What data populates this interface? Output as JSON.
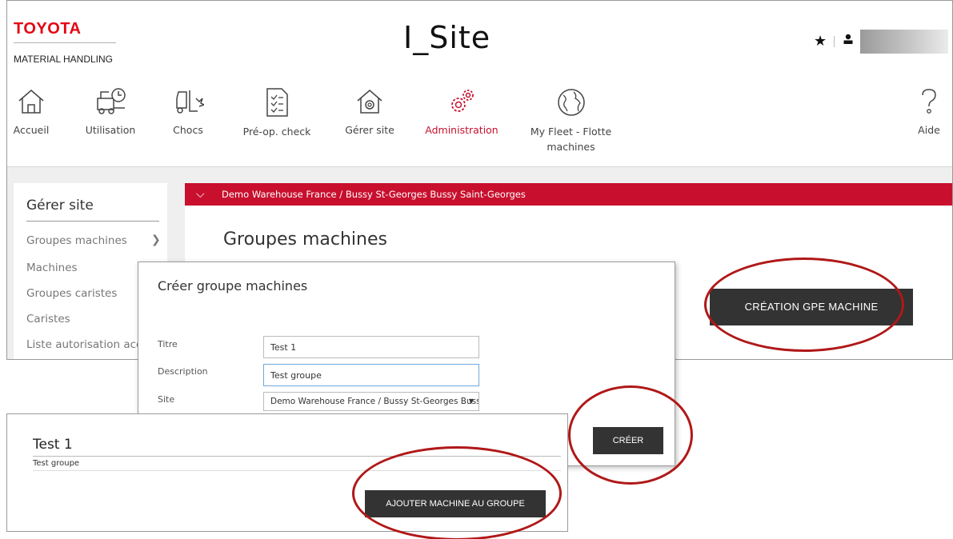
{
  "brand": {
    "name": "TOYOTA",
    "subtitle": "MATERIAL HANDLING"
  },
  "app_title": "I_Site",
  "header": {
    "star_icon": "★",
    "user_icon": "👤"
  },
  "nav": [
    {
      "label": "Accueil",
      "icon": "home-icon"
    },
    {
      "label": "Utilisation",
      "icon": "forklift-clock-icon"
    },
    {
      "label": "Chocs",
      "icon": "forklift-impact-icon"
    },
    {
      "label": "Pré-op. check",
      "icon": "checklist-icon"
    },
    {
      "label": "Gérer site",
      "icon": "house-gear-icon"
    },
    {
      "label": "Administration",
      "icon": "gears-icon",
      "active": true
    },
    {
      "label": "My Fleet - Flotte machines",
      "icon": "globe-icon"
    },
    {
      "label": "Aide",
      "icon": "question-icon"
    }
  ],
  "sidebar": {
    "title": "Gérer site",
    "items": [
      "Groupes machines",
      "Machines",
      "Groupes caristes",
      "Caristes",
      "Liste autorisation accès"
    ]
  },
  "location": "Demo Warehouse France / Bussy St-Georges Bussy Saint-Georges",
  "content_title": "Groupes machines",
  "create_button": "CRÉATION GPE MACHINE",
  "dialog": {
    "title": "Créer groupe machines",
    "labels": {
      "title": "Titre",
      "description": "Description",
      "site": "Site"
    },
    "values": {
      "title": "Test 1",
      "description": "Test groupe",
      "site": "Demo Warehouse France / Bussy St-Georges Bussy Saint-Georges"
    },
    "submit": "CRÉER"
  },
  "group": {
    "title": "Test 1",
    "description": "Test groupe",
    "add_button": "AJOUTER MACHINE AU GROUPE"
  },
  "colors": {
    "brand_red": "#e30613",
    "accent": "#c8102e",
    "button_dark": "#333333",
    "highlight": "#b01818"
  }
}
